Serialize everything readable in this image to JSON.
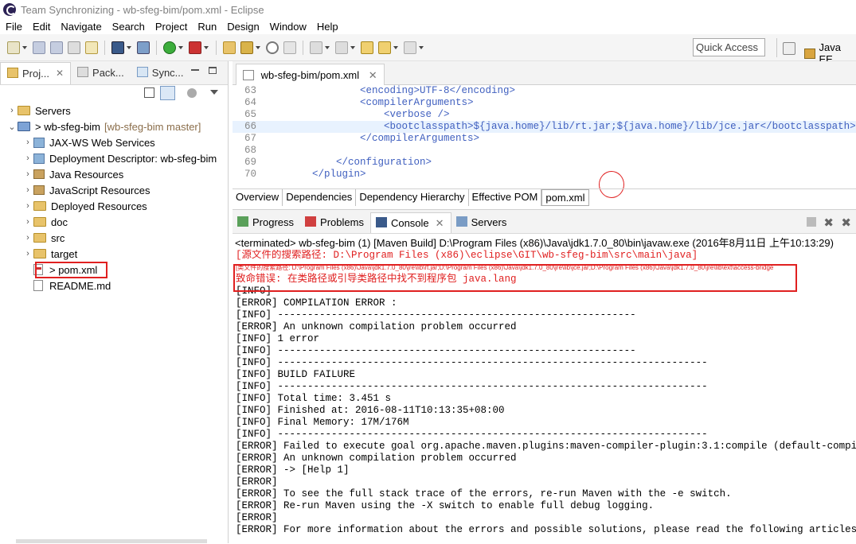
{
  "window": {
    "title": "Team Synchronizing - wb-sfeg-bim/pom.xml - Eclipse"
  },
  "menu": [
    "File",
    "Edit",
    "Navigate",
    "Search",
    "Project",
    "Run",
    "Design",
    "Window",
    "Help"
  ],
  "toolbar": {
    "quick_access": "Quick Access",
    "perspective": "Java EE"
  },
  "left_tabs": [
    "Proj...",
    "Pack...",
    "Sync..."
  ],
  "tree": [
    {
      "label": "Servers",
      "type": "folder",
      "indent": 0,
      "arrow": ">"
    },
    {
      "label": "> wb-sfeg-bim",
      "suffix": "[wb-sfeg-bim master]",
      "type": "project",
      "indent": 0,
      "arrow": "v"
    },
    {
      "label": "JAX-WS Web Services",
      "type": "pkg",
      "indent": 1,
      "arrow": ">"
    },
    {
      "label": "Deployment Descriptor: wb-sfeg-bim",
      "type": "pkg",
      "indent": 1,
      "arrow": ">"
    },
    {
      "label": "Java Resources",
      "type": "jar",
      "indent": 1,
      "arrow": ">"
    },
    {
      "label": "JavaScript Resources",
      "type": "jar",
      "indent": 1,
      "arrow": ">"
    },
    {
      "label": "Deployed Resources",
      "type": "folder",
      "indent": 1,
      "arrow": ">"
    },
    {
      "label": "doc",
      "type": "folder",
      "indent": 1,
      "arrow": ">"
    },
    {
      "label": "src",
      "type": "folder",
      "indent": 1,
      "arrow": ">"
    },
    {
      "label": "target",
      "type": "folder",
      "indent": 1,
      "arrow": ">"
    },
    {
      "label": "> pom.xml",
      "type": "file",
      "indent": 1,
      "arrow": ""
    },
    {
      "label": "README.md",
      "type": "file",
      "indent": 1,
      "arrow": ""
    }
  ],
  "editor": {
    "tab": "wb-sfeg-bim/pom.xml",
    "lines": [
      {
        "n": "63",
        "text": "                <encoding>UTF-8</encoding>"
      },
      {
        "n": "64",
        "text": "                <compilerArguments>"
      },
      {
        "n": "65",
        "text": "                    <verbose />"
      },
      {
        "n": "66",
        "text": "                    <bootclasspath>${java.home}/lib/rt.jar;${java.home}/lib/jce.jar</bootclasspath>"
      },
      {
        "n": "67",
        "text": "                </compilerArguments>"
      },
      {
        "n": "68",
        "text": ""
      },
      {
        "n": "69",
        "text": "            </configuration>"
      },
      {
        "n": "70",
        "text": "        </plugin>"
      }
    ],
    "pom_tabs": [
      "Overview",
      "Dependencies",
      "Dependency Hierarchy",
      "Effective POM",
      "pom.xml"
    ]
  },
  "console": {
    "tabs": [
      "Progress",
      "Problems",
      "Console",
      "Servers"
    ],
    "status": "<terminated> wb-sfeg-bim (1) [Maven Build] D:\\Program Files (x86)\\Java\\jdk1.7.0_80\\bin\\javaw.exe (2016年8月11日 上午10:13:29)",
    "red_lines": [
      "[源文件的搜索路径: D:\\Program Files (x86)\\eclipse\\GIT\\wb-sfeg-bim\\src\\main\\java]",
      "[类文件的搜索路径: D:\\Program Files (x86)\\Java\\jdk1.7.0_80\\jre\\lib\\rt.jar;D:\\Program Files (x86)\\Java\\jdk1.7.0_80\\jre\\lib\\jce.jar;D:\\Program Files (x86)\\Java\\jdk1.7.0_80\\jre\\lib\\ext\\access-bridge",
      "致命错误: 在类路径或引导类路径中找不到程序包 java.lang"
    ],
    "lines": [
      "[INFO] ------------------------------------------------------------",
      "[ERROR] COMPILATION ERROR :",
      "[INFO] ------------------------------------------------------------",
      "[ERROR] An unknown compilation problem occurred",
      "[INFO] 1 error",
      "[INFO] ------------------------------------------------------------",
      "[INFO] ------------------------------------------------------------------------",
      "[INFO] BUILD FAILURE",
      "[INFO] ------------------------------------------------------------------------",
      "[INFO] Total time: 3.451 s",
      "[INFO] Finished at: 2016-08-11T10:13:35+08:00",
      "[INFO] Final Memory: 17M/176M",
      "[INFO] ------------------------------------------------------------------------",
      "[ERROR] Failed to execute goal org.apache.maven.plugins:maven-compiler-plugin:3.1:compile (default-compile) on p",
      "[ERROR] An unknown compilation problem occurred",
      "[ERROR] -> [Help 1]",
      "[ERROR]",
      "[ERROR] To see the full stack trace of the errors, re-run Maven with the -e switch.",
      "[ERROR] Re-run Maven using the -X switch to enable full debug logging.",
      "[ERROR]",
      "[ERROR] For more information about the errors and possible solutions, please read the following articles:"
    ]
  }
}
